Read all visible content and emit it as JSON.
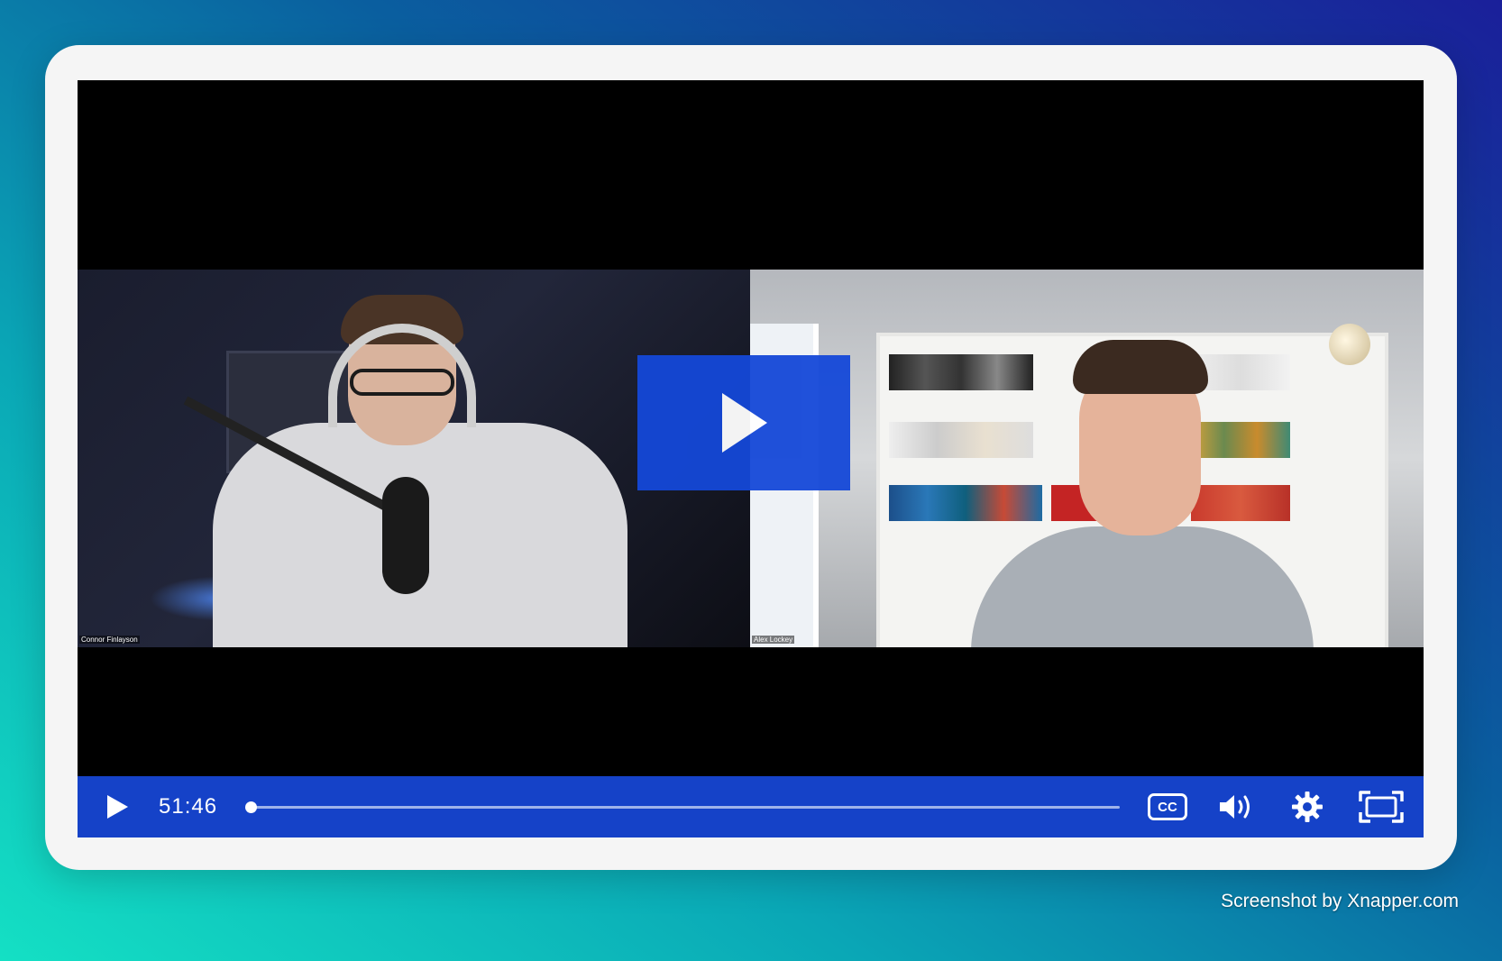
{
  "video": {
    "participants": [
      {
        "name": "Connor Finlayson"
      },
      {
        "name": "Alex Lockey"
      }
    ],
    "current_time": "51:46",
    "progress_fraction": 0.004
  },
  "controls": {
    "play_icon": "play-icon",
    "cc_label": "CC",
    "volume_icon": "volume-icon",
    "settings_icon": "gear-icon",
    "fullscreen_icon": "fullscreen-icon"
  },
  "colors": {
    "controls_bg": "#1542c8",
    "big_play_bg": "#1448d8"
  },
  "watermark": "Screenshot by Xnapper.com"
}
